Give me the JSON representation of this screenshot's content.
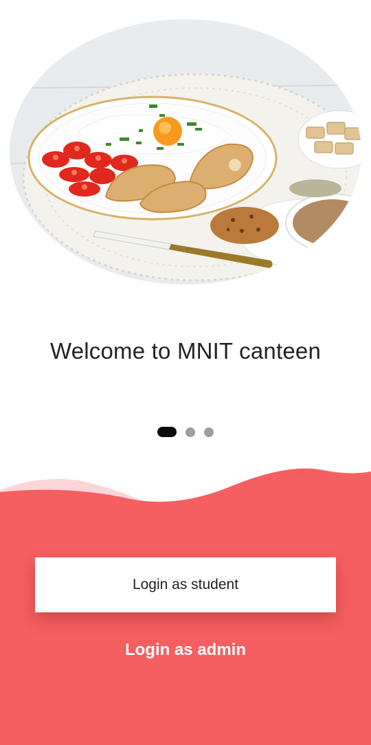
{
  "onboarding": {
    "hero_image": "breakfast-plate-image",
    "welcome_text": "Welcome to MNIT canteen",
    "pager": {
      "total": 3,
      "active_index": 0
    }
  },
  "actions": {
    "student_login_label": "Login as student",
    "admin_login_label": "Login as admin"
  },
  "colors": {
    "accent": "#f65f61",
    "accent_light": "#fbd5d7",
    "button_background": "#ffffff",
    "active_dot": "#0a0a0a",
    "inactive_dot": "#9e9e9e"
  }
}
